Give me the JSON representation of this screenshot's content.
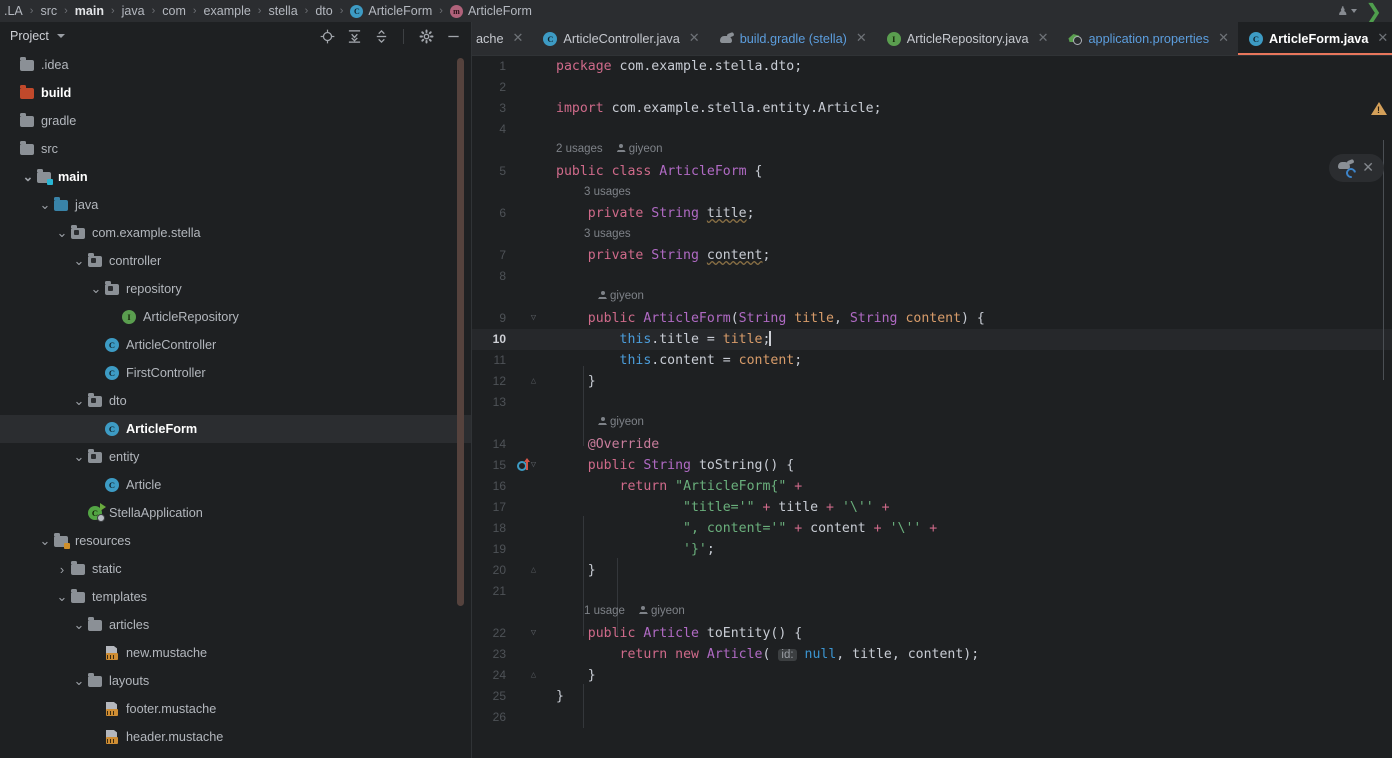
{
  "breadcrumbs": [
    {
      "label": ".LA",
      "icon": null,
      "bold": false
    },
    {
      "label": "src",
      "icon": null,
      "bold": false
    },
    {
      "label": "main",
      "icon": null,
      "bold": true
    },
    {
      "label": "java",
      "icon": null,
      "bold": false
    },
    {
      "label": "com",
      "icon": null,
      "bold": false
    },
    {
      "label": "example",
      "icon": null,
      "bold": false
    },
    {
      "label": "stella",
      "icon": null,
      "bold": false
    },
    {
      "label": "dto",
      "icon": null,
      "bold": false
    },
    {
      "label": "ArticleForm",
      "icon": "class-icon",
      "bold": false
    },
    {
      "label": "ArticleForm",
      "icon": "method-icon",
      "bold": false
    }
  ],
  "titlebar": {
    "avatar_icon": "user-avatar-icon",
    "dropdown_icon": "chevron-down-icon",
    "run_icon": "run-chevron-icon"
  },
  "project_panel": {
    "title": "Project",
    "dropdown_icon": "chevron-down-icon",
    "tools": [
      {
        "name": "select-opened-file-icon",
        "glyph": "locate"
      },
      {
        "name": "expand-all-icon",
        "glyph": "expand"
      },
      {
        "name": "collapse-all-icon",
        "glyph": "collapse"
      },
      {
        "name": "settings-gear-icon",
        "glyph": "gear"
      },
      {
        "name": "hide-panel-icon",
        "glyph": "minus"
      }
    ],
    "tree": [
      {
        "label": ".idea",
        "depth": 0,
        "arrow": "",
        "icon": "folder",
        "style": "",
        "selected": false
      },
      {
        "label": "build",
        "depth": 0,
        "arrow": "",
        "icon": "folder-red",
        "style": "bold-w",
        "selected": false
      },
      {
        "label": "gradle",
        "depth": 0,
        "arrow": "",
        "icon": "folder",
        "style": "",
        "selected": false
      },
      {
        "label": "src",
        "depth": 0,
        "arrow": "",
        "icon": "folder",
        "style": "",
        "selected": false
      },
      {
        "label": "main",
        "depth": 1,
        "arrow": "v",
        "icon": "folder-src",
        "style": "bold-w",
        "selected": false
      },
      {
        "label": "java",
        "depth": 2,
        "arrow": "v",
        "icon": "folder-blue",
        "style": "",
        "selected": false
      },
      {
        "label": "com.example.stella",
        "depth": 3,
        "arrow": "v",
        "icon": "package",
        "style": "",
        "selected": false
      },
      {
        "label": "controller",
        "depth": 4,
        "arrow": "v",
        "icon": "package",
        "style": "",
        "selected": false
      },
      {
        "label": "repository",
        "depth": 5,
        "arrow": "v",
        "icon": "package",
        "style": "",
        "selected": false
      },
      {
        "label": "ArticleRepository",
        "depth": 6,
        "arrow": "",
        "icon": "interface",
        "style": "",
        "selected": false
      },
      {
        "label": "ArticleController",
        "depth": 5,
        "arrow": "",
        "icon": "class",
        "style": "",
        "selected": false
      },
      {
        "label": "FirstController",
        "depth": 5,
        "arrow": "",
        "icon": "class",
        "style": "",
        "selected": false
      },
      {
        "label": "dto",
        "depth": 4,
        "arrow": "v",
        "icon": "package",
        "style": "",
        "selected": false
      },
      {
        "label": "ArticleForm",
        "depth": 5,
        "arrow": "",
        "icon": "class",
        "style": "bold-w",
        "selected": true
      },
      {
        "label": "entity",
        "depth": 4,
        "arrow": "v",
        "icon": "package",
        "style": "",
        "selected": false
      },
      {
        "label": "Article",
        "depth": 5,
        "arrow": "",
        "icon": "class",
        "style": "",
        "selected": false
      },
      {
        "label": "StellaApplication",
        "depth": 4,
        "arrow": "",
        "icon": "spring-app",
        "style": "",
        "selected": false
      },
      {
        "label": "resources",
        "depth": 2,
        "arrow": "v",
        "icon": "folder-res",
        "style": "",
        "selected": false
      },
      {
        "label": "static",
        "depth": 3,
        "arrow": ">",
        "icon": "folder",
        "style": "",
        "selected": false
      },
      {
        "label": "templates",
        "depth": 3,
        "arrow": "v",
        "icon": "folder",
        "style": "",
        "selected": false
      },
      {
        "label": "articles",
        "depth": 4,
        "arrow": "v",
        "icon": "folder",
        "style": "",
        "selected": false
      },
      {
        "label": "new.mustache",
        "depth": 5,
        "arrow": "",
        "icon": "mustache",
        "style": "",
        "selected": false
      },
      {
        "label": "layouts",
        "depth": 4,
        "arrow": "v",
        "icon": "folder",
        "style": "",
        "selected": false
      },
      {
        "label": "footer.mustache",
        "depth": 5,
        "arrow": "",
        "icon": "mustache",
        "style": "",
        "selected": false
      },
      {
        "label": "header.mustache",
        "depth": 5,
        "arrow": "",
        "icon": "mustache",
        "style": "",
        "selected": false
      }
    ]
  },
  "editor_tabs": [
    {
      "label": "ache",
      "icon": "mustache-icon",
      "active": false,
      "blue": false,
      "partial": true
    },
    {
      "label": "ArticleController.java",
      "icon": "class-icon",
      "active": false,
      "blue": false,
      "partial": false
    },
    {
      "label": "build.gradle (stella)",
      "icon": "gradle-icon",
      "active": false,
      "blue": true,
      "partial": false
    },
    {
      "label": "ArticleRepository.java",
      "icon": "interface-icon",
      "active": false,
      "blue": false,
      "partial": false
    },
    {
      "label": "application.properties",
      "icon": "spring-properties-icon",
      "active": false,
      "blue": true,
      "partial": false
    },
    {
      "label": "ArticleForm.java",
      "icon": "class-icon",
      "active": true,
      "blue": false,
      "partial": false
    }
  ],
  "code": {
    "file": "ArticleForm.java",
    "current_line": 10,
    "last_line_number": 26,
    "lines": [
      {
        "n": 1,
        "html": "<span class='kw'>package</span> <span class='plain'>com.example.stella.dto</span><span class='plain'>;</span>"
      },
      {
        "n": 2,
        "html": ""
      },
      {
        "n": 3,
        "html": "<span class='kw'>import</span> <span class='plain'>com.example.stella.entity.Article</span><span class='plain'>;</span>"
      },
      {
        "n": 4,
        "html": ""
      },
      {
        "hint": "2 usages",
        "author": "giyeon",
        "indent": 0
      },
      {
        "n": 5,
        "html": "<span class='kw'>public</span> <span class='kw'>class</span> <span class='typ'>ArticleForm</span> <span class='plain'>{</span>"
      },
      {
        "hint": "3 usages",
        "author": null,
        "indent": 1
      },
      {
        "n": 6,
        "html": "    <span class='kw'>private</span> <span class='typ'>String</span> <span class='ident typewarn'>title</span><span class='plain'>;</span>"
      },
      {
        "hint": "3 usages",
        "author": null,
        "indent": 1
      },
      {
        "n": 7,
        "html": "    <span class='kw'>private</span> <span class='typ'>String</span> <span class='ident typewarn'>content</span><span class='plain'>;</span>"
      },
      {
        "n": 8,
        "html": ""
      },
      {
        "hint": null,
        "author": "giyeon",
        "indent": 1
      },
      {
        "n": 9,
        "html": "    <span class='kw'>public</span> <span class='typ'>ArticleForm</span><span class='plain'>(</span><span class='typ'>String</span> <span class='param'>title</span><span class='plain'>, </span><span class='typ'>String</span> <span class='param'>content</span><span class='plain'>) {</span>",
        "fold": true
      },
      {
        "n": 10,
        "html": "        <span class='thisk'>this</span><span class='plain'>.title = </span><span class='param'>title</span><span class='plain'>;</span><span class='caret'></span>",
        "current": true
      },
      {
        "n": 11,
        "html": "        <span class='thisk'>this</span><span class='plain'>.content = </span><span class='param'>content</span><span class='plain'>;</span>"
      },
      {
        "n": 12,
        "html": "    <span class='plain'>}</span>",
        "foldend": true
      },
      {
        "n": 13,
        "html": ""
      },
      {
        "hint": null,
        "author": "giyeon",
        "indent": 1
      },
      {
        "n": 14,
        "html": "    <span class='anno'>@Override</span>"
      },
      {
        "n": 15,
        "html": "    <span class='kw'>public</span> <span class='typ'>String</span> <span class='plain'>toString() {</span>",
        "fold": true,
        "override": true
      },
      {
        "n": 16,
        "html": "        <span class='kw'>return</span> <span class='str'>\"ArticleForm{\"</span> <span class='kw'>+</span>"
      },
      {
        "n": 17,
        "html": "                <span class='str'>\"title='\"</span> <span class='kw'>+</span> <span class='plain'>title</span> <span class='kw'>+</span> <span class='str'>'\\''</span> <span class='kw'>+</span>"
      },
      {
        "n": 18,
        "html": "                <span class='str'>\", content='\"</span> <span class='kw'>+</span> <span class='plain'>content</span> <span class='kw'>+</span> <span class='str'>'\\''</span> <span class='kw'>+</span>"
      },
      {
        "n": 19,
        "html": "                <span class='str'>'}'</span><span class='plain'>;</span>"
      },
      {
        "n": 20,
        "html": "    <span class='plain'>}</span>",
        "foldend": true
      },
      {
        "n": 21,
        "html": ""
      },
      {
        "hint": "1 usage",
        "author": "giyeon",
        "indent": 1
      },
      {
        "n": 22,
        "html": "    <span class='kw'>public</span> <span class='typ'>Article</span> <span class='plain'>toEntity() {</span>",
        "fold": true
      },
      {
        "n": 23,
        "html": "        <span class='kw'>return</span> <span class='kw'>new</span> <span class='typ'>Article</span><span class='plain'>(</span> <span class='phint'>id:</span> <span class='num'>null</span><span class='plain'>, title, content);</span>"
      },
      {
        "n": 24,
        "html": "    <span class='plain'>}</span>",
        "foldend": true
      },
      {
        "n": 25,
        "html": "<span class='plain'>}</span>"
      },
      {
        "n": 26,
        "html": ""
      }
    ]
  },
  "overlays": {
    "warning_icon": "warning-triangle-icon",
    "warning_glyph": "!",
    "notification": {
      "icon": "gradle-reload-icon",
      "close_icon": "close-icon"
    }
  },
  "colors": {
    "background": "#1e2022",
    "panel_background": "#2b2d30",
    "selection": "#2b2d30",
    "active_tab_underline": "#e8765c",
    "keyword": "#cf6a8a",
    "type": "#b06ac4",
    "string": "#6aaf7c",
    "number": "#3b95d1",
    "parameter": "#d89c6a",
    "this_keyword": "#4b9ddb",
    "annotation": "#c97d9c",
    "link_blue": "#5c9ede",
    "folder_red": "#c1492b",
    "folder_blue": "#3983a8",
    "class_icon": "#3d9bc4",
    "interface_icon": "#5a9e4f"
  }
}
